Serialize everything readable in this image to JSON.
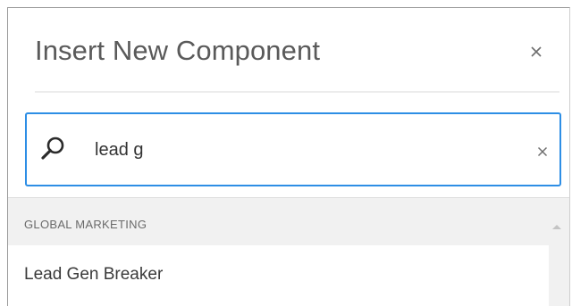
{
  "dialog": {
    "title": "Insert New Component",
    "close_icon": "close-icon"
  },
  "search": {
    "value": "lead g",
    "icon": "search-icon",
    "clear_icon": "clear-icon",
    "focus_color": "#2d8ee5"
  },
  "results": {
    "groups": [
      {
        "header": "GLOBAL MARKETING",
        "items": [
          {
            "label": "Lead Gen Breaker"
          }
        ]
      }
    ],
    "scroll_icon": "chevron-up-icon"
  }
}
